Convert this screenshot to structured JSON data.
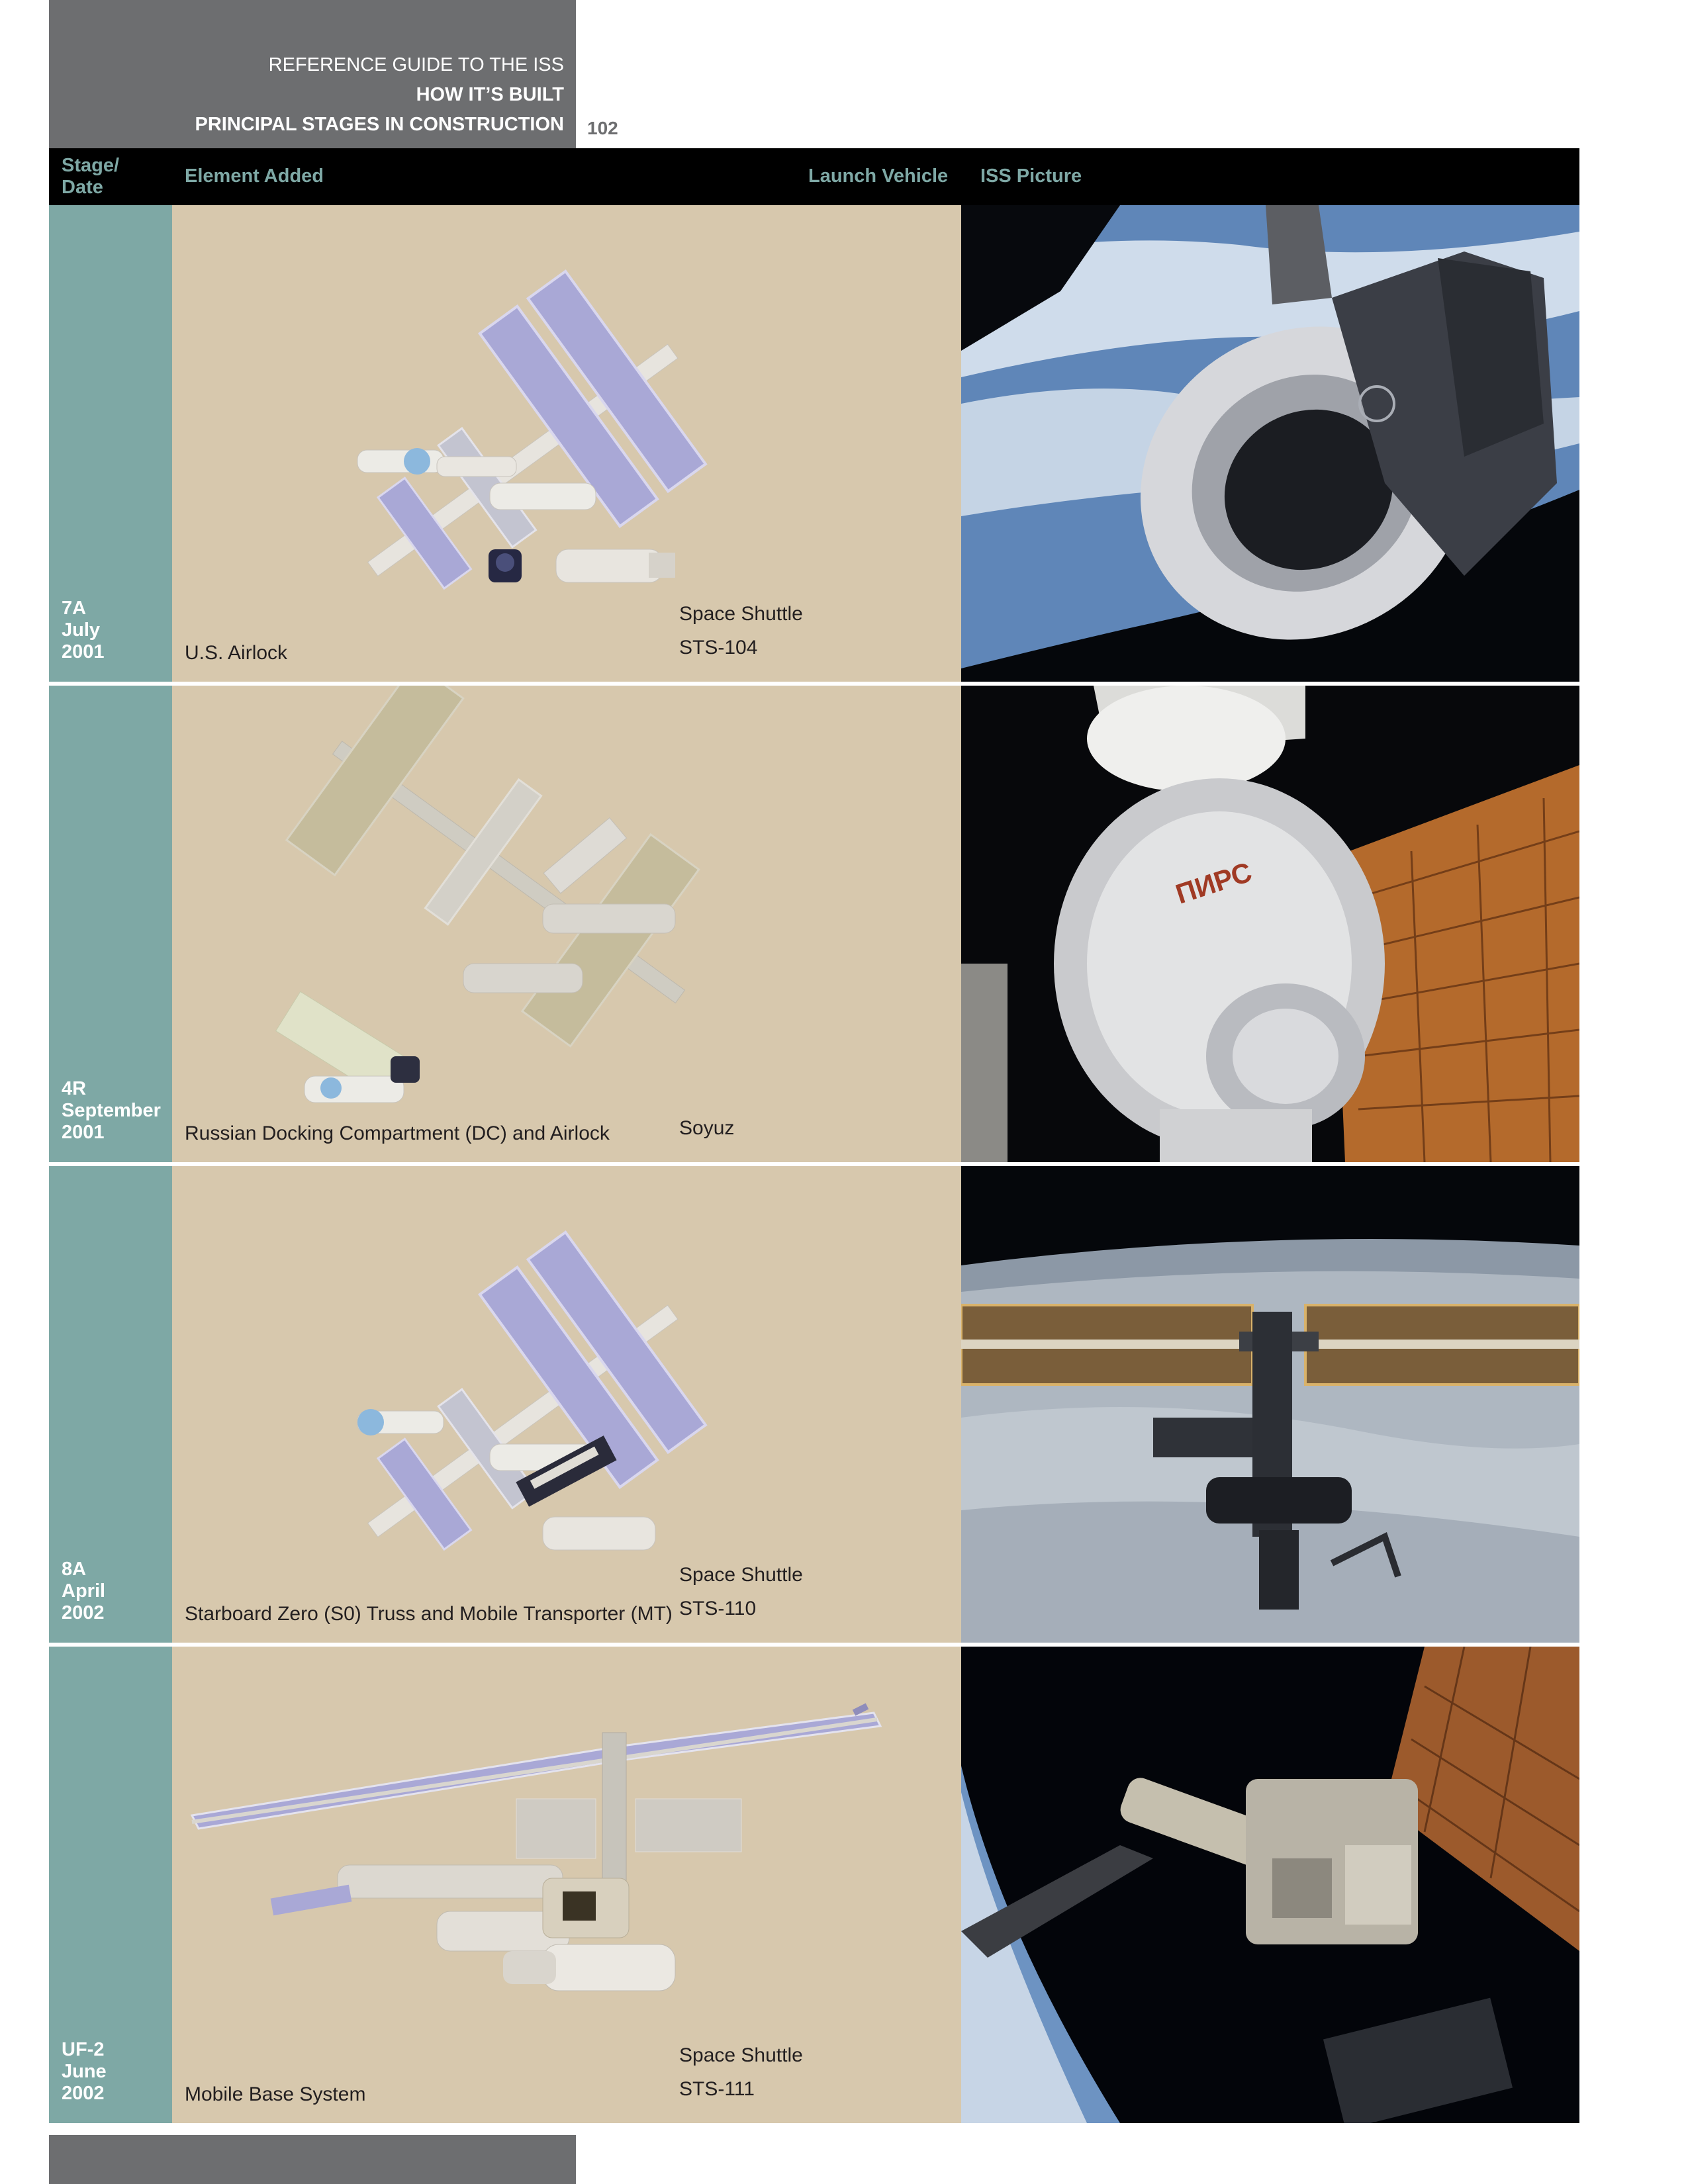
{
  "header": {
    "line1": "REFERENCE GUIDE TO THE ISS",
    "line2": "HOW IT’S BUILT",
    "line3": "PRINCIPAL STAGES IN CONSTRUCTION",
    "page_number": "102"
  },
  "table": {
    "columns": {
      "stage_line1": "Stage/",
      "stage_line2": "Date",
      "element": "Element Added",
      "vehicle": "Launch Vehicle",
      "picture": "ISS Picture"
    },
    "rows": [
      {
        "stage": "7A",
        "month": "July",
        "year": "2001",
        "element": "U.S. Airlock",
        "vehicle_line1": "Space Shuttle",
        "vehicle_line2": "STS-104"
      },
      {
        "stage": "4R",
        "month": "September",
        "year": "2001",
        "element": "Russian Docking Compartment (DC) and Airlock",
        "vehicle_line1": "",
        "vehicle_line2": "Soyuz"
      },
      {
        "stage": "8A",
        "month": "April",
        "year": "2002",
        "element": "Starboard Zero (S0) Truss and Mobile Transporter (MT)",
        "vehicle_line1": "Space Shuttle",
        "vehicle_line2": "STS-110"
      },
      {
        "stage": "UF-2",
        "month": "June",
        "year": "2002",
        "element": "Mobile Base System",
        "vehicle_line1": "Space Shuttle",
        "vehicle_line2": "STS-111"
      }
    ]
  },
  "photo_module_lettering": "ПИРС",
  "colors": {
    "header_band": "#6d6e70",
    "stage_column": "#7ea8a5",
    "element_column": "#d7c8ad",
    "table_header": "#000000",
    "solar_array": "#a9a8d6"
  }
}
